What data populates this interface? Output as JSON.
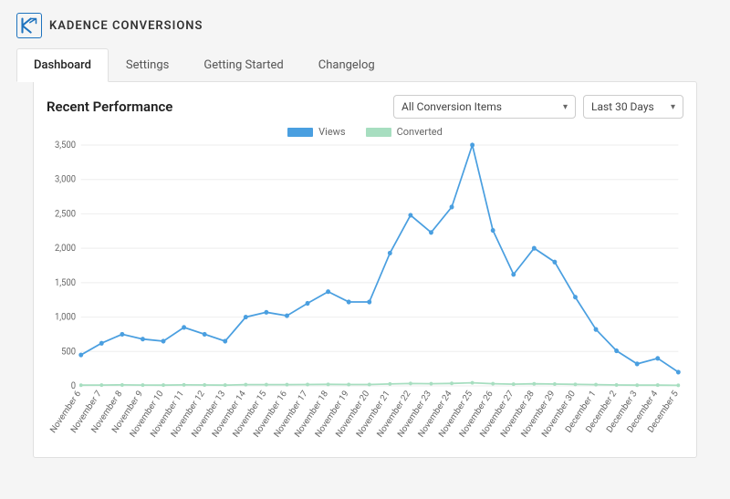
{
  "brand": {
    "name": "KADENCE CONVERSIONS"
  },
  "tabs": [
    {
      "label": "Dashboard",
      "active": true
    },
    {
      "label": "Settings",
      "active": false
    },
    {
      "label": "Getting Started",
      "active": false
    },
    {
      "label": "Changelog",
      "active": false
    }
  ],
  "section": {
    "title": "Recent Performance"
  },
  "filters": {
    "items": {
      "selected": "All Conversion Items"
    },
    "range": {
      "selected": "Last 30 Days"
    }
  },
  "legend": {
    "views": "Views",
    "converted": "Converted"
  },
  "chart_data": {
    "type": "line",
    "title": "Recent Performance",
    "xlabel": "",
    "ylabel": "",
    "ylim": [
      0,
      3500
    ],
    "yticks": [
      0,
      500,
      1000,
      1500,
      2000,
      2500,
      3000,
      3500
    ],
    "categories": [
      "November 6",
      "November 7",
      "November 8",
      "November 9",
      "November 10",
      "November 11",
      "November 12",
      "November 13",
      "November 14",
      "November 15",
      "November 16",
      "November 17",
      "November 18",
      "November 19",
      "November 20",
      "November 21",
      "November 22",
      "November 23",
      "November 24",
      "November 25",
      "November 26",
      "November 27",
      "November 28",
      "November 29",
      "November 30",
      "December 1",
      "December 2",
      "December 3",
      "December 4",
      "December 5"
    ],
    "series": [
      {
        "name": "Views",
        "color": "#4a9fe0",
        "values": [
          450,
          620,
          750,
          680,
          650,
          850,
          750,
          650,
          1000,
          1070,
          1020,
          1200,
          1370,
          1220,
          1220,
          1930,
          2480,
          2230,
          2600,
          3500,
          2260,
          1620,
          2000,
          1800,
          1290,
          820,
          510,
          320,
          400,
          200
        ]
      },
      {
        "name": "Converted",
        "color": "#a7dec0",
        "values": [
          10,
          12,
          14,
          12,
          11,
          15,
          13,
          11,
          18,
          19,
          18,
          20,
          22,
          20,
          20,
          28,
          35,
          32,
          36,
          45,
          32,
          25,
          30,
          27,
          22,
          18,
          13,
          10,
          11,
          8
        ]
      }
    ]
  }
}
